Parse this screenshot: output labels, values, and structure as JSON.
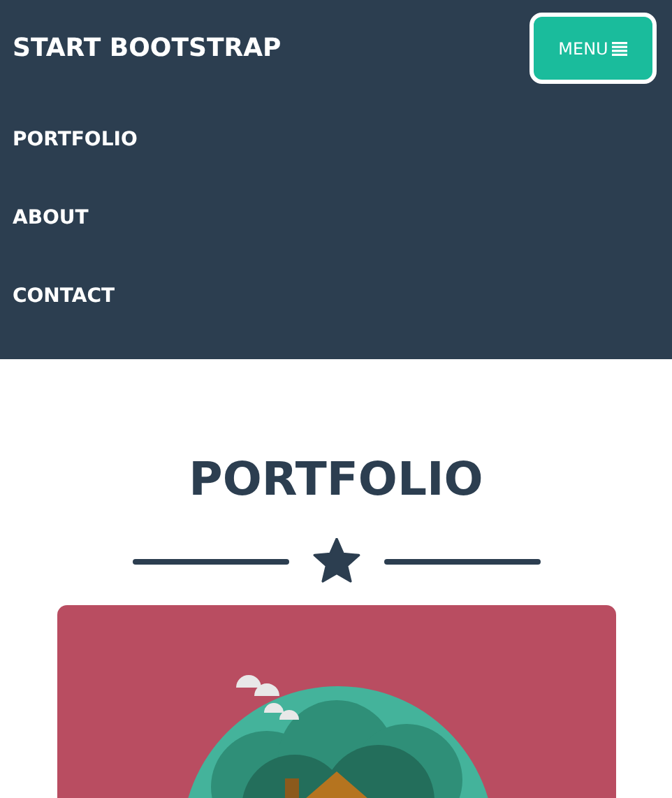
{
  "navbar": {
    "brand": "START BOOTSTRAP",
    "menu_button": {
      "label": "MENU",
      "expanded": true
    },
    "items": [
      {
        "label": "PORTFOLIO"
      },
      {
        "label": "ABOUT"
      },
      {
        "label": "CONTACT"
      }
    ]
  },
  "section": {
    "title": "PORTFOLIO"
  }
}
